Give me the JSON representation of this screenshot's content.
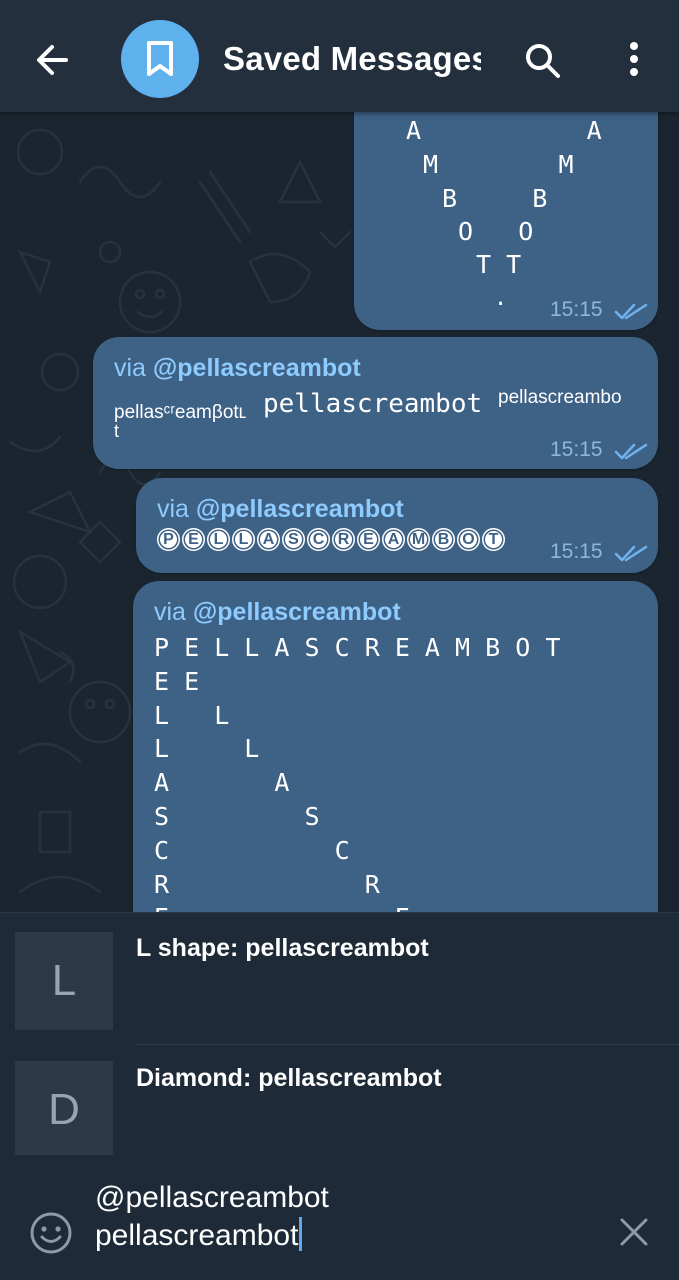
{
  "header": {
    "title": "Saved Messages",
    "avatar_icon": "bookmark-icon",
    "back_icon": "arrow-left-icon",
    "search_icon": "search-icon",
    "menu_icon": "more-vertical-icon"
  },
  "colors": {
    "header_bg": "#232f3d",
    "chat_bg": "#1a252f",
    "bubble_bg": "#3e6186",
    "avatar_bg": "#5fb1ee",
    "link": "#8ecbff",
    "time": "#8cb8dd",
    "cursor": "#5ea9ee"
  },
  "messages": [
    {
      "art_lines": [
        "A           A",
        "M        M",
        "B     B",
        "O   O",
        "T T",
        "."
      ],
      "time": "15:15",
      "status": "double-check-icon"
    },
    {
      "via_prefix": "via ",
      "via_bot": "@pellascreambot",
      "styled_small": "pellasᶜʳeamβotʟ",
      "styled_mono": "pellascreambot",
      "styled_super": "pellascreambo",
      "styled_wrap": "t",
      "time": "15:15",
      "status": "double-check-icon"
    },
    {
      "via_prefix": "via ",
      "via_bot": "@pellascreambot",
      "circled": [
        "P",
        "E",
        "L",
        "L",
        "A",
        "S",
        "C",
        "R",
        "E",
        "A",
        "M",
        "B",
        "O",
        "T"
      ],
      "time": "15:15",
      "status": "double-check-icon"
    },
    {
      "via_prefix": "via ",
      "via_bot": "@pellascreambot",
      "art_lines": [
        "P E L L A S C R E A M B O T",
        "E E",
        "L   L",
        "L     L",
        "A       A",
        "S         S",
        "C           C",
        "R             R",
        "E               E"
      ]
    }
  ],
  "suggestions": [
    {
      "thumb": "L",
      "label": "L shape: pellascreambot"
    },
    {
      "thumb": "D",
      "label": "Diamond: pellascreambot"
    }
  ],
  "input": {
    "line1": "@pellascreambot",
    "line2": "pellascreambot",
    "emoji_icon": "smile-icon",
    "clear_icon": "close-icon"
  }
}
